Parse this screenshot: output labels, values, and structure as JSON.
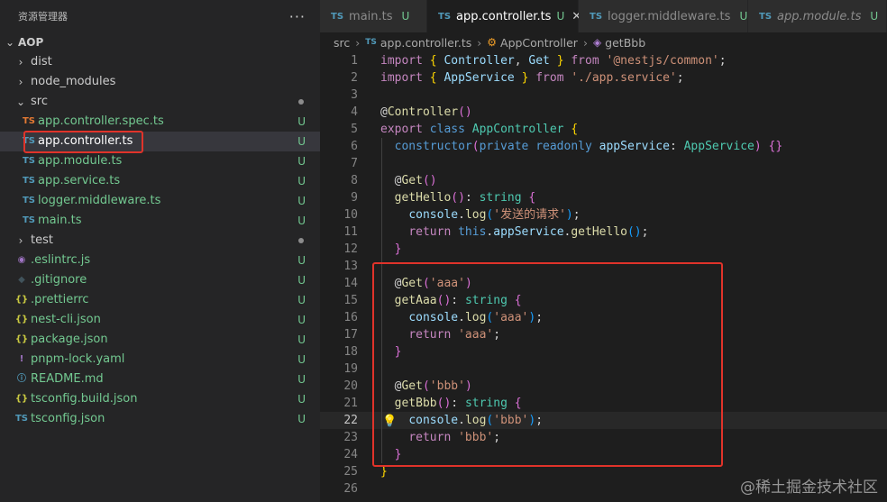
{
  "explorer": {
    "title": "资源管理器",
    "more": "···",
    "root": "AOP",
    "items": [
      {
        "label": "dist",
        "type": "folder",
        "status": ""
      },
      {
        "label": "node_modules",
        "type": "folder",
        "status": ""
      },
      {
        "label": "src",
        "type": "folder-open",
        "status": "dot"
      },
      {
        "label": "app.controller.spec.ts",
        "type": "ts-spec",
        "status": "U"
      },
      {
        "label": "app.controller.ts",
        "type": "ts",
        "status": "U"
      },
      {
        "label": "app.module.ts",
        "type": "ts",
        "status": "U"
      },
      {
        "label": "app.service.ts",
        "type": "ts",
        "status": "U"
      },
      {
        "label": "logger.middleware.ts",
        "type": "ts",
        "status": "U"
      },
      {
        "label": "main.ts",
        "type": "ts",
        "status": "U"
      },
      {
        "label": "test",
        "type": "folder",
        "status": "dot"
      },
      {
        "label": ".eslintrc.js",
        "type": "eslint",
        "status": "U"
      },
      {
        "label": ".gitignore",
        "type": "git",
        "status": "U"
      },
      {
        "label": ".prettierrc",
        "type": "json",
        "status": "U"
      },
      {
        "label": "nest-cli.json",
        "type": "json",
        "status": "U"
      },
      {
        "label": "package.json",
        "type": "json",
        "status": "U"
      },
      {
        "label": "pnpm-lock.yaml",
        "type": "yaml",
        "status": "U"
      },
      {
        "label": "README.md",
        "type": "md",
        "status": "U"
      },
      {
        "label": "tsconfig.build.json",
        "type": "json",
        "status": "U"
      },
      {
        "label": "tsconfig.json",
        "type": "tsconfig",
        "status": "U"
      }
    ]
  },
  "tabs": [
    {
      "label": "main.ts",
      "status": "U",
      "badge": "TS"
    },
    {
      "label": "app.controller.ts",
      "status": "U",
      "badge": "TS",
      "close": "✕"
    },
    {
      "label": "logger.middleware.ts",
      "status": "U",
      "badge": "TS"
    },
    {
      "label": "app.module.ts",
      "status": "U",
      "badge": "TS"
    }
  ],
  "breadcrumb": {
    "folder": "src",
    "file": "app.controller.ts",
    "file_badge": "TS",
    "class": "AppController",
    "method": "getBbb"
  },
  "editor": {
    "line_numbers": [
      "1",
      "2",
      "3",
      "4",
      "5",
      "6",
      "7",
      "8",
      "9",
      "10",
      "11",
      "12",
      "13",
      "14",
      "15",
      "16",
      "17",
      "18",
      "19",
      "20",
      "21",
      "22",
      "23",
      "24",
      "25",
      "26"
    ],
    "current_line": 22
  },
  "watermark": "@稀土掘金技术社区",
  "colors": {
    "highlight_box": "#e0332a",
    "status_untracked": "#73c991",
    "ts_icon": "#519aba"
  }
}
